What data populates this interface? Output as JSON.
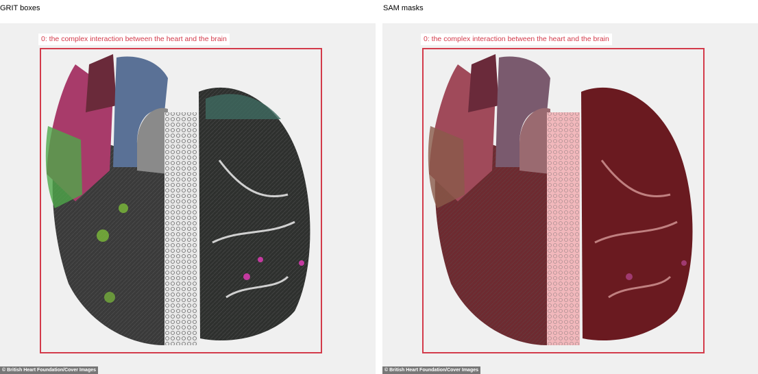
{
  "colors": {
    "box": "#d33a4a",
    "mask": "#8b1a24",
    "panel_bg": "#f0f0f0"
  },
  "left_panel": {
    "title": "GRIT boxes",
    "caption": "0: the complex interaction between the heart and the brain",
    "credit": "© British Heart Foundation/Cover Images"
  },
  "right_panel": {
    "title": "SAM masks",
    "caption": "0: the complex interaction between the heart and the brain",
    "credit": "© British Heart Foundation/Cover Images"
  }
}
